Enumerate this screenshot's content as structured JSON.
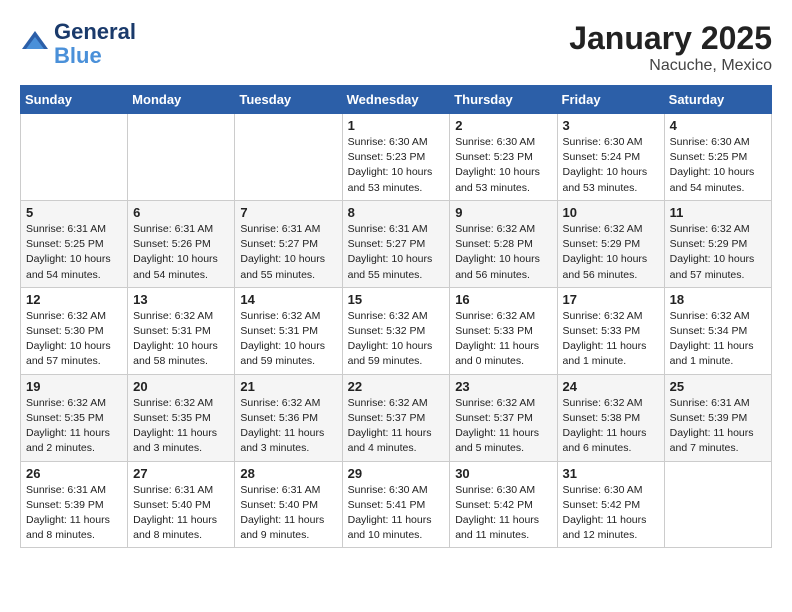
{
  "header": {
    "logo_line1": "General",
    "logo_line2": "Blue",
    "month_year": "January 2025",
    "location": "Nacuche, Mexico"
  },
  "days_of_week": [
    "Sunday",
    "Monday",
    "Tuesday",
    "Wednesday",
    "Thursday",
    "Friday",
    "Saturday"
  ],
  "weeks": [
    [
      {
        "day": "",
        "info": ""
      },
      {
        "day": "",
        "info": ""
      },
      {
        "day": "",
        "info": ""
      },
      {
        "day": "1",
        "info": "Sunrise: 6:30 AM\nSunset: 5:23 PM\nDaylight: 10 hours\nand 53 minutes."
      },
      {
        "day": "2",
        "info": "Sunrise: 6:30 AM\nSunset: 5:23 PM\nDaylight: 10 hours\nand 53 minutes."
      },
      {
        "day": "3",
        "info": "Sunrise: 6:30 AM\nSunset: 5:24 PM\nDaylight: 10 hours\nand 53 minutes."
      },
      {
        "day": "4",
        "info": "Sunrise: 6:30 AM\nSunset: 5:25 PM\nDaylight: 10 hours\nand 54 minutes."
      }
    ],
    [
      {
        "day": "5",
        "info": "Sunrise: 6:31 AM\nSunset: 5:25 PM\nDaylight: 10 hours\nand 54 minutes."
      },
      {
        "day": "6",
        "info": "Sunrise: 6:31 AM\nSunset: 5:26 PM\nDaylight: 10 hours\nand 54 minutes."
      },
      {
        "day": "7",
        "info": "Sunrise: 6:31 AM\nSunset: 5:27 PM\nDaylight: 10 hours\nand 55 minutes."
      },
      {
        "day": "8",
        "info": "Sunrise: 6:31 AM\nSunset: 5:27 PM\nDaylight: 10 hours\nand 55 minutes."
      },
      {
        "day": "9",
        "info": "Sunrise: 6:32 AM\nSunset: 5:28 PM\nDaylight: 10 hours\nand 56 minutes."
      },
      {
        "day": "10",
        "info": "Sunrise: 6:32 AM\nSunset: 5:29 PM\nDaylight: 10 hours\nand 56 minutes."
      },
      {
        "day": "11",
        "info": "Sunrise: 6:32 AM\nSunset: 5:29 PM\nDaylight: 10 hours\nand 57 minutes."
      }
    ],
    [
      {
        "day": "12",
        "info": "Sunrise: 6:32 AM\nSunset: 5:30 PM\nDaylight: 10 hours\nand 57 minutes."
      },
      {
        "day": "13",
        "info": "Sunrise: 6:32 AM\nSunset: 5:31 PM\nDaylight: 10 hours\nand 58 minutes."
      },
      {
        "day": "14",
        "info": "Sunrise: 6:32 AM\nSunset: 5:31 PM\nDaylight: 10 hours\nand 59 minutes."
      },
      {
        "day": "15",
        "info": "Sunrise: 6:32 AM\nSunset: 5:32 PM\nDaylight: 10 hours\nand 59 minutes."
      },
      {
        "day": "16",
        "info": "Sunrise: 6:32 AM\nSunset: 5:33 PM\nDaylight: 11 hours\nand 0 minutes."
      },
      {
        "day": "17",
        "info": "Sunrise: 6:32 AM\nSunset: 5:33 PM\nDaylight: 11 hours\nand 1 minute."
      },
      {
        "day": "18",
        "info": "Sunrise: 6:32 AM\nSunset: 5:34 PM\nDaylight: 11 hours\nand 1 minute."
      }
    ],
    [
      {
        "day": "19",
        "info": "Sunrise: 6:32 AM\nSunset: 5:35 PM\nDaylight: 11 hours\nand 2 minutes."
      },
      {
        "day": "20",
        "info": "Sunrise: 6:32 AM\nSunset: 5:35 PM\nDaylight: 11 hours\nand 3 minutes."
      },
      {
        "day": "21",
        "info": "Sunrise: 6:32 AM\nSunset: 5:36 PM\nDaylight: 11 hours\nand 3 minutes."
      },
      {
        "day": "22",
        "info": "Sunrise: 6:32 AM\nSunset: 5:37 PM\nDaylight: 11 hours\nand 4 minutes."
      },
      {
        "day": "23",
        "info": "Sunrise: 6:32 AM\nSunset: 5:37 PM\nDaylight: 11 hours\nand 5 minutes."
      },
      {
        "day": "24",
        "info": "Sunrise: 6:32 AM\nSunset: 5:38 PM\nDaylight: 11 hours\nand 6 minutes."
      },
      {
        "day": "25",
        "info": "Sunrise: 6:31 AM\nSunset: 5:39 PM\nDaylight: 11 hours\nand 7 minutes."
      }
    ],
    [
      {
        "day": "26",
        "info": "Sunrise: 6:31 AM\nSunset: 5:39 PM\nDaylight: 11 hours\nand 8 minutes."
      },
      {
        "day": "27",
        "info": "Sunrise: 6:31 AM\nSunset: 5:40 PM\nDaylight: 11 hours\nand 8 minutes."
      },
      {
        "day": "28",
        "info": "Sunrise: 6:31 AM\nSunset: 5:40 PM\nDaylight: 11 hours\nand 9 minutes."
      },
      {
        "day": "29",
        "info": "Sunrise: 6:30 AM\nSunset: 5:41 PM\nDaylight: 11 hours\nand 10 minutes."
      },
      {
        "day": "30",
        "info": "Sunrise: 6:30 AM\nSunset: 5:42 PM\nDaylight: 11 hours\nand 11 minutes."
      },
      {
        "day": "31",
        "info": "Sunrise: 6:30 AM\nSunset: 5:42 PM\nDaylight: 11 hours\nand 12 minutes."
      },
      {
        "day": "",
        "info": ""
      }
    ]
  ]
}
